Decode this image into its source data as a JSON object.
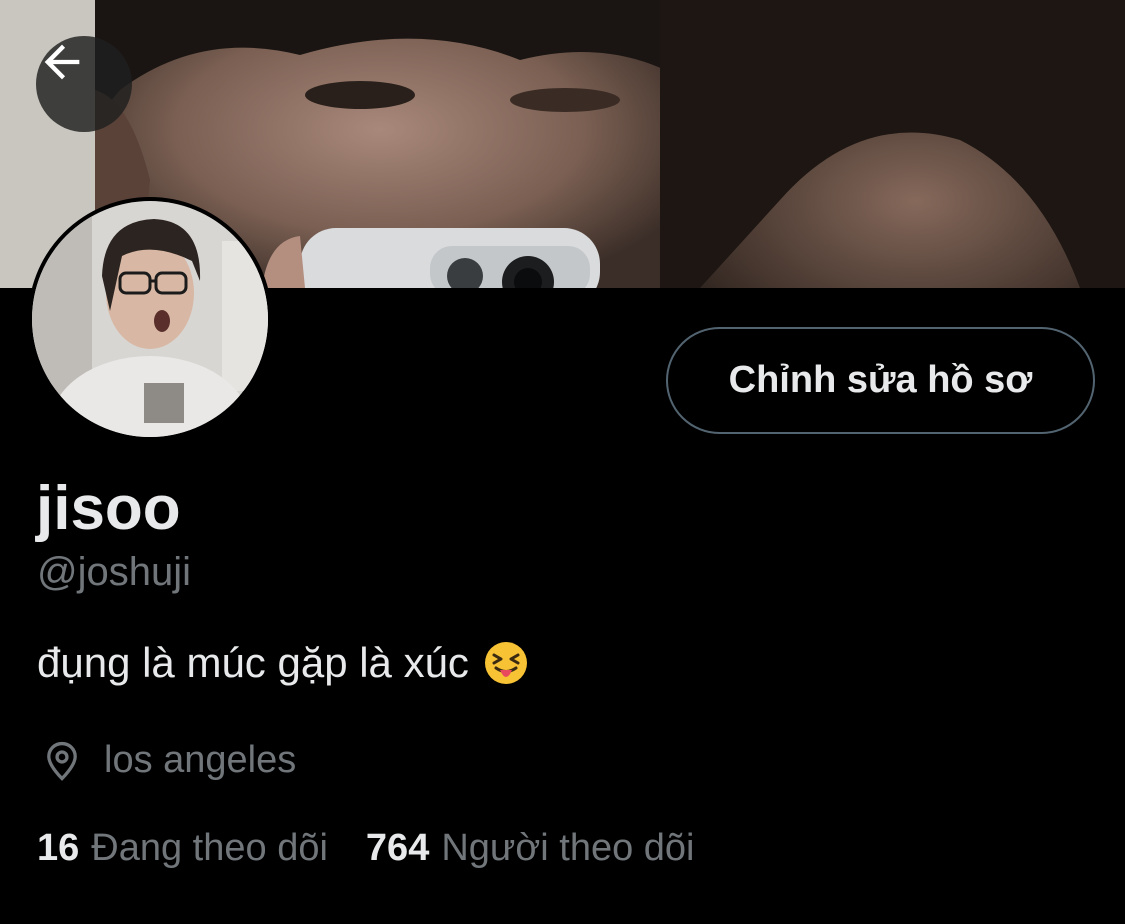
{
  "profile": {
    "display_name": "jisoo",
    "handle": "@joshuji",
    "bio": "đụng là múc gặp là xúc",
    "bio_emoji": "squinting-face-with-tongue-icon",
    "location": "los angeles"
  },
  "actions": {
    "edit_profile_label": "Chỉnh sửa hồ sơ",
    "back_icon": "arrow-left-icon"
  },
  "stats": {
    "following_count": "16",
    "following_label": "Đang theo dõi",
    "followers_count": "764",
    "followers_label": "Người theo dõi"
  },
  "colors": {
    "background": "#000000",
    "primary_text": "#e7e9ea",
    "secondary_text": "#71767b",
    "button_border": "#536471"
  }
}
